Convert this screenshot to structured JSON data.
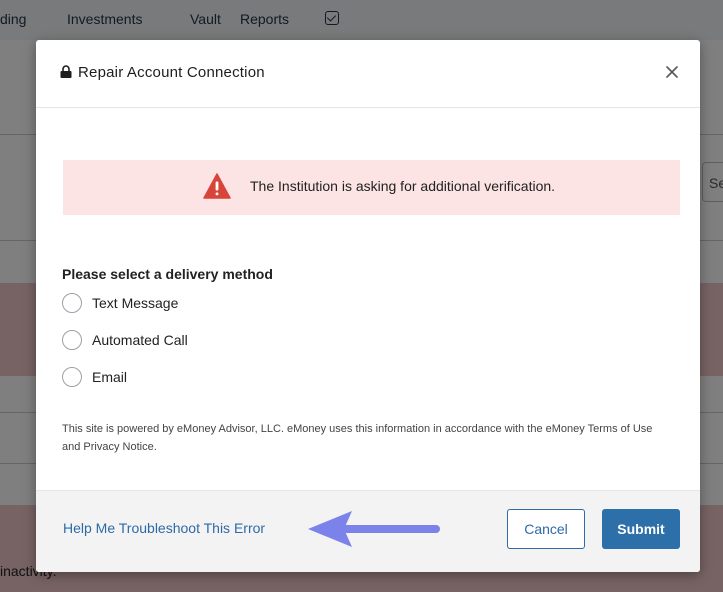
{
  "background": {
    "nav_items": [
      "ding",
      "Investments",
      "Vault",
      "Reports"
    ],
    "search_fragment": "Se",
    "bottom_text": "inactivity."
  },
  "modal": {
    "title": "Repair Account Connection",
    "alert_text": "The Institution is asking for additional verification.",
    "section_title": "Please select a delivery method",
    "delivery_options": [
      "Text Message",
      "Automated Call",
      "Email"
    ],
    "disclaimer": "This site is powered by eMoney Advisor, LLC. eMoney uses this information in accordance with the eMoney Terms of Use and Privacy Notice.",
    "help_link": "Help Me Troubleshoot This Error",
    "cancel_label": "Cancel",
    "submit_label": "Submit"
  },
  "colors": {
    "primary": "#2c6fa9",
    "alert_bg": "#fce4e4",
    "warning": "#d9443a",
    "annotation_arrow": "#7b83ea"
  },
  "icons": [
    "lock-icon",
    "close-icon",
    "warning-icon",
    "arrow-annotation"
  ]
}
